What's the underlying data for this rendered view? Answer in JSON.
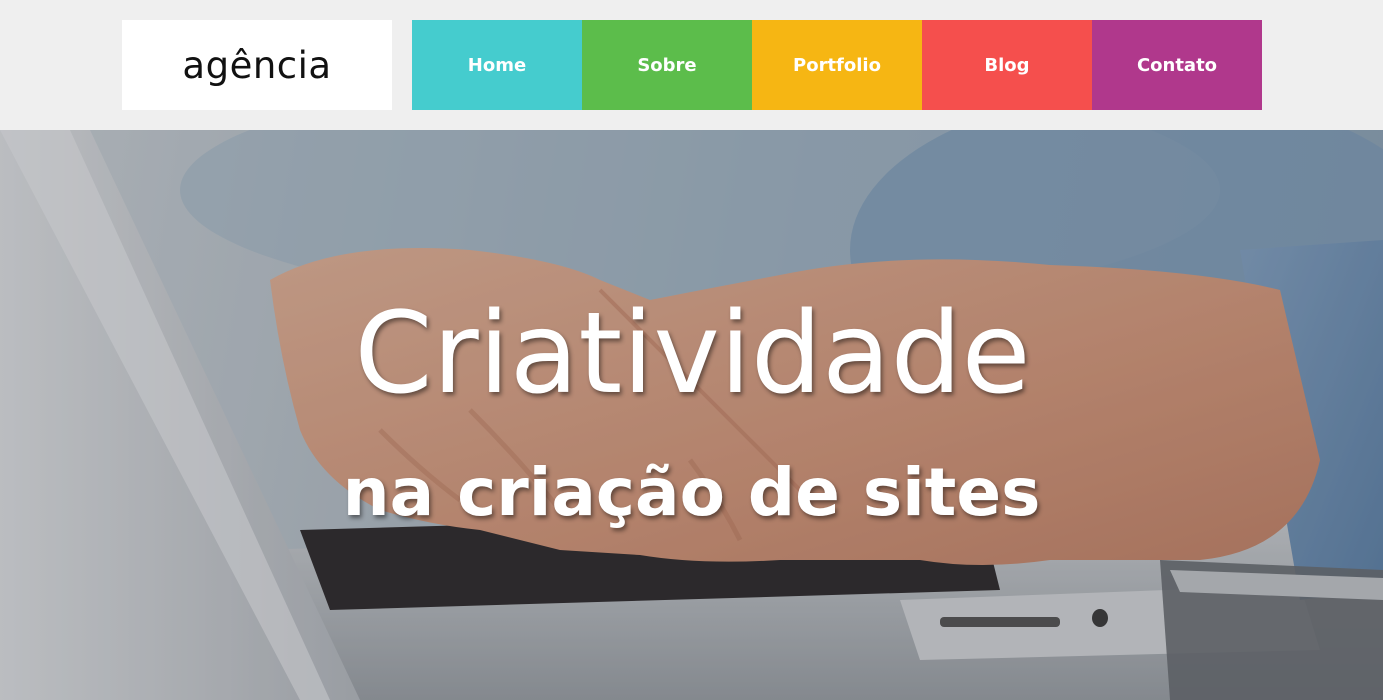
{
  "header": {
    "logo_text": "agência",
    "nav": [
      {
        "label": "Home",
        "color": "#45ccce"
      },
      {
        "label": "Sobre",
        "color": "#5cbd4b"
      },
      {
        "label": "Portfolio",
        "color": "#f6b613"
      },
      {
        "label": "Blog",
        "color": "#f54f4d"
      },
      {
        "label": "Contato",
        "color": "#b0388c"
      }
    ]
  },
  "hero": {
    "title": "Criatividade",
    "subtitle": "na criação de sites",
    "background_image": "hands-typing-on-laptop"
  }
}
